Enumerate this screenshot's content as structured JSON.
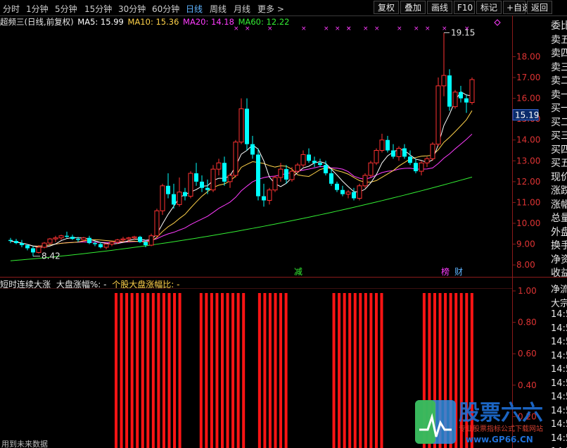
{
  "toolbar": {
    "timeframes": [
      "分时",
      "1分钟",
      "5分钟",
      "15分钟",
      "30分钟",
      "60分钟",
      "日线",
      "周线",
      "月线",
      "更多 >"
    ],
    "active_timeframe": "日线",
    "buttons": [
      "复权",
      "叠加",
      "画线",
      "F10",
      "标记",
      "+自选",
      "返回"
    ]
  },
  "info": {
    "title": "超频三(日线,前复权)",
    "ma5": "MA5: 15.99",
    "ma10": "MA10: 15.36",
    "ma20": "MA20: 14.18",
    "ma60": "MA60: 12.22"
  },
  "price_axis": {
    "ticks": [
      "18.00",
      "17.00",
      "16.00",
      "15.00",
      "14.00",
      "13.00",
      "12.00",
      "11.00",
      "10.00",
      "9.00",
      "8.00"
    ],
    "current": "15.19"
  },
  "annotations": {
    "high": "19.15",
    "low": "8.42",
    "tag1": "减",
    "tag2": "榜",
    "tag3": "财"
  },
  "indicator": {
    "title": "短时连续大涨",
    "market_label": "大盘涨幅%: -",
    "stock_label": "个股大盘涨幅比: -",
    "axis": [
      "1.00",
      "0.80",
      "0.60",
      "0.40",
      "0.20"
    ]
  },
  "right_panel": {
    "items": [
      "委比",
      "卖五",
      "卖四",
      "卖三",
      "卖二",
      "卖一",
      "买一",
      "买二",
      "买三",
      "买四",
      "买五",
      "现价",
      "涨跌",
      "涨幅",
      "总量",
      "外盘",
      "换手",
      "净资",
      "收益"
    ],
    "lower_items": [
      "净流",
      "大宗",
      "14:5",
      "14:5",
      "14:5",
      "14:5",
      "14:5",
      "14:5",
      "14:5",
      "14:5",
      "14:5",
      "14:5",
      "14:5"
    ]
  },
  "footer": "用到未来数据",
  "watermark": {
    "title": "股票六六",
    "subtitle": "专业股票指标公式下载网站",
    "url": "www.GP66.CN"
  },
  "chart_data": {
    "type": "candlestick",
    "y_range": [
      7.7,
      19.2
    ],
    "days": 88,
    "ohlc": [
      [
        9.2,
        9.3,
        9.05,
        9.15
      ],
      [
        9.15,
        9.25,
        9.0,
        9.05
      ],
      [
        9.05,
        9.2,
        8.85,
        8.95
      ],
      [
        8.95,
        9.0,
        8.7,
        8.8
      ],
      [
        8.8,
        8.9,
        8.42,
        8.6
      ],
      [
        8.6,
        8.95,
        8.55,
        8.85
      ],
      [
        8.85,
        9.1,
        8.8,
        9.05
      ],
      [
        9.05,
        9.3,
        9.0,
        9.25
      ],
      [
        9.25,
        9.4,
        9.1,
        9.3
      ],
      [
        9.3,
        9.45,
        9.2,
        9.4
      ],
      [
        9.4,
        9.6,
        9.3,
        9.35
      ],
      [
        9.35,
        9.45,
        9.2,
        9.25
      ],
      [
        9.25,
        9.35,
        9.1,
        9.2
      ],
      [
        9.2,
        9.35,
        9.1,
        9.3
      ],
      [
        9.3,
        9.4,
        9.0,
        9.05
      ],
      [
        9.05,
        9.15,
        8.9,
        9.0
      ],
      [
        9.0,
        9.1,
        8.8,
        8.85
      ],
      [
        8.85,
        9.05,
        8.75,
        9.0
      ],
      [
        9.0,
        9.15,
        8.9,
        9.1
      ],
      [
        9.1,
        9.25,
        9.0,
        9.2
      ],
      [
        9.2,
        9.35,
        9.1,
        9.25
      ],
      [
        9.25,
        9.35,
        9.1,
        9.3
      ],
      [
        9.3,
        9.4,
        9.2,
        9.35
      ],
      [
        9.35,
        9.4,
        9.05,
        9.1
      ],
      [
        9.1,
        9.2,
        8.85,
        8.95
      ],
      [
        8.95,
        9.5,
        8.9,
        9.4
      ],
      [
        9.4,
        10.7,
        9.35,
        10.6
      ],
      [
        10.6,
        11.9,
        10.4,
        11.8
      ],
      [
        11.8,
        12.4,
        11.2,
        11.4
      ],
      [
        11.4,
        11.9,
        10.7,
        10.9
      ],
      [
        10.9,
        12.2,
        10.8,
        11.5
      ],
      [
        11.5,
        11.7,
        11.1,
        11.3
      ],
      [
        11.3,
        12.5,
        11.2,
        12.4
      ],
      [
        12.4,
        12.9,
        11.8,
        12.0
      ],
      [
        12.0,
        12.3,
        11.5,
        11.7
      ],
      [
        11.7,
        12.1,
        11.4,
        11.6
      ],
      [
        11.6,
        12.8,
        11.5,
        12.6
      ],
      [
        12.6,
        13.1,
        12.3,
        12.9
      ],
      [
        12.9,
        13.2,
        11.8,
        12.0
      ],
      [
        12.0,
        12.4,
        11.7,
        12.3
      ],
      [
        12.3,
        14.0,
        12.2,
        13.9
      ],
      [
        13.9,
        16.0,
        13.8,
        15.5
      ],
      [
        15.5,
        16.0,
        13.5,
        13.8
      ],
      [
        13.8,
        14.2,
        13.1,
        13.3
      ],
      [
        13.3,
        13.6,
        11.1,
        11.3
      ],
      [
        11.3,
        11.9,
        10.8,
        11.1
      ],
      [
        11.1,
        11.7,
        10.9,
        11.6
      ],
      [
        11.6,
        12.3,
        11.5,
        12.2
      ],
      [
        12.2,
        12.9,
        12.0,
        12.6
      ],
      [
        12.6,
        12.8,
        11.9,
        12.1
      ],
      [
        12.1,
        12.7,
        12.0,
        12.5
      ],
      [
        12.5,
        12.9,
        12.4,
        12.8
      ],
      [
        12.8,
        13.5,
        12.7,
        13.3
      ],
      [
        13.3,
        13.6,
        12.9,
        13.0
      ],
      [
        13.0,
        13.2,
        12.7,
        12.9
      ],
      [
        12.9,
        13.1,
        12.7,
        12.8
      ],
      [
        12.8,
        13.0,
        12.3,
        12.4
      ],
      [
        12.4,
        12.6,
        11.8,
        11.9
      ],
      [
        11.9,
        12.0,
        11.5,
        11.6
      ],
      [
        11.6,
        11.8,
        11.3,
        11.4
      ],
      [
        11.4,
        11.6,
        11.2,
        11.5
      ],
      [
        11.5,
        11.7,
        11.1,
        11.2
      ],
      [
        11.2,
        11.9,
        11.1,
        11.8
      ],
      [
        11.8,
        12.4,
        11.7,
        12.3
      ],
      [
        12.3,
        13.0,
        12.2,
        12.9
      ],
      [
        12.9,
        13.6,
        12.8,
        13.5
      ],
      [
        13.5,
        14.3,
        13.4,
        14.0
      ],
      [
        14.0,
        14.2,
        13.4,
        13.5
      ],
      [
        13.5,
        13.8,
        13.1,
        13.2
      ],
      [
        13.2,
        13.7,
        13.0,
        13.6
      ],
      [
        13.6,
        13.8,
        13.1,
        13.2
      ],
      [
        13.2,
        13.5,
        12.8,
        12.9
      ],
      [
        12.9,
        13.1,
        12.4,
        12.5
      ],
      [
        12.5,
        13.0,
        12.3,
        12.9
      ],
      [
        12.9,
        13.2,
        12.7,
        13.1
      ],
      [
        13.1,
        13.9,
        13.0,
        13.8
      ],
      [
        13.8,
        17.0,
        13.7,
        16.6
      ],
      [
        16.6,
        19.15,
        16.1,
        17.1
      ],
      [
        17.1,
        17.4,
        15.4,
        15.6
      ],
      [
        15.6,
        16.4,
        15.5,
        16.3
      ],
      [
        16.3,
        16.6,
        15.8,
        16.0
      ],
      [
        16.0,
        16.2,
        15.3,
        15.8
      ],
      [
        15.8,
        17.0,
        15.7,
        16.9
      ]
    ],
    "ma60_start": 8.2,
    "ma60_end": 12.22,
    "signal_bars": [
      [
        20,
        32
      ],
      [
        36,
        44
      ],
      [
        47,
        52
      ],
      [
        61,
        70
      ],
      [
        78,
        87
      ]
    ],
    "top_markers": [
      57,
      60,
      66,
      75,
      80,
      84,
      86,
      87,
      90,
      93,
      100,
      103,
      107,
      111,
      116
    ]
  }
}
